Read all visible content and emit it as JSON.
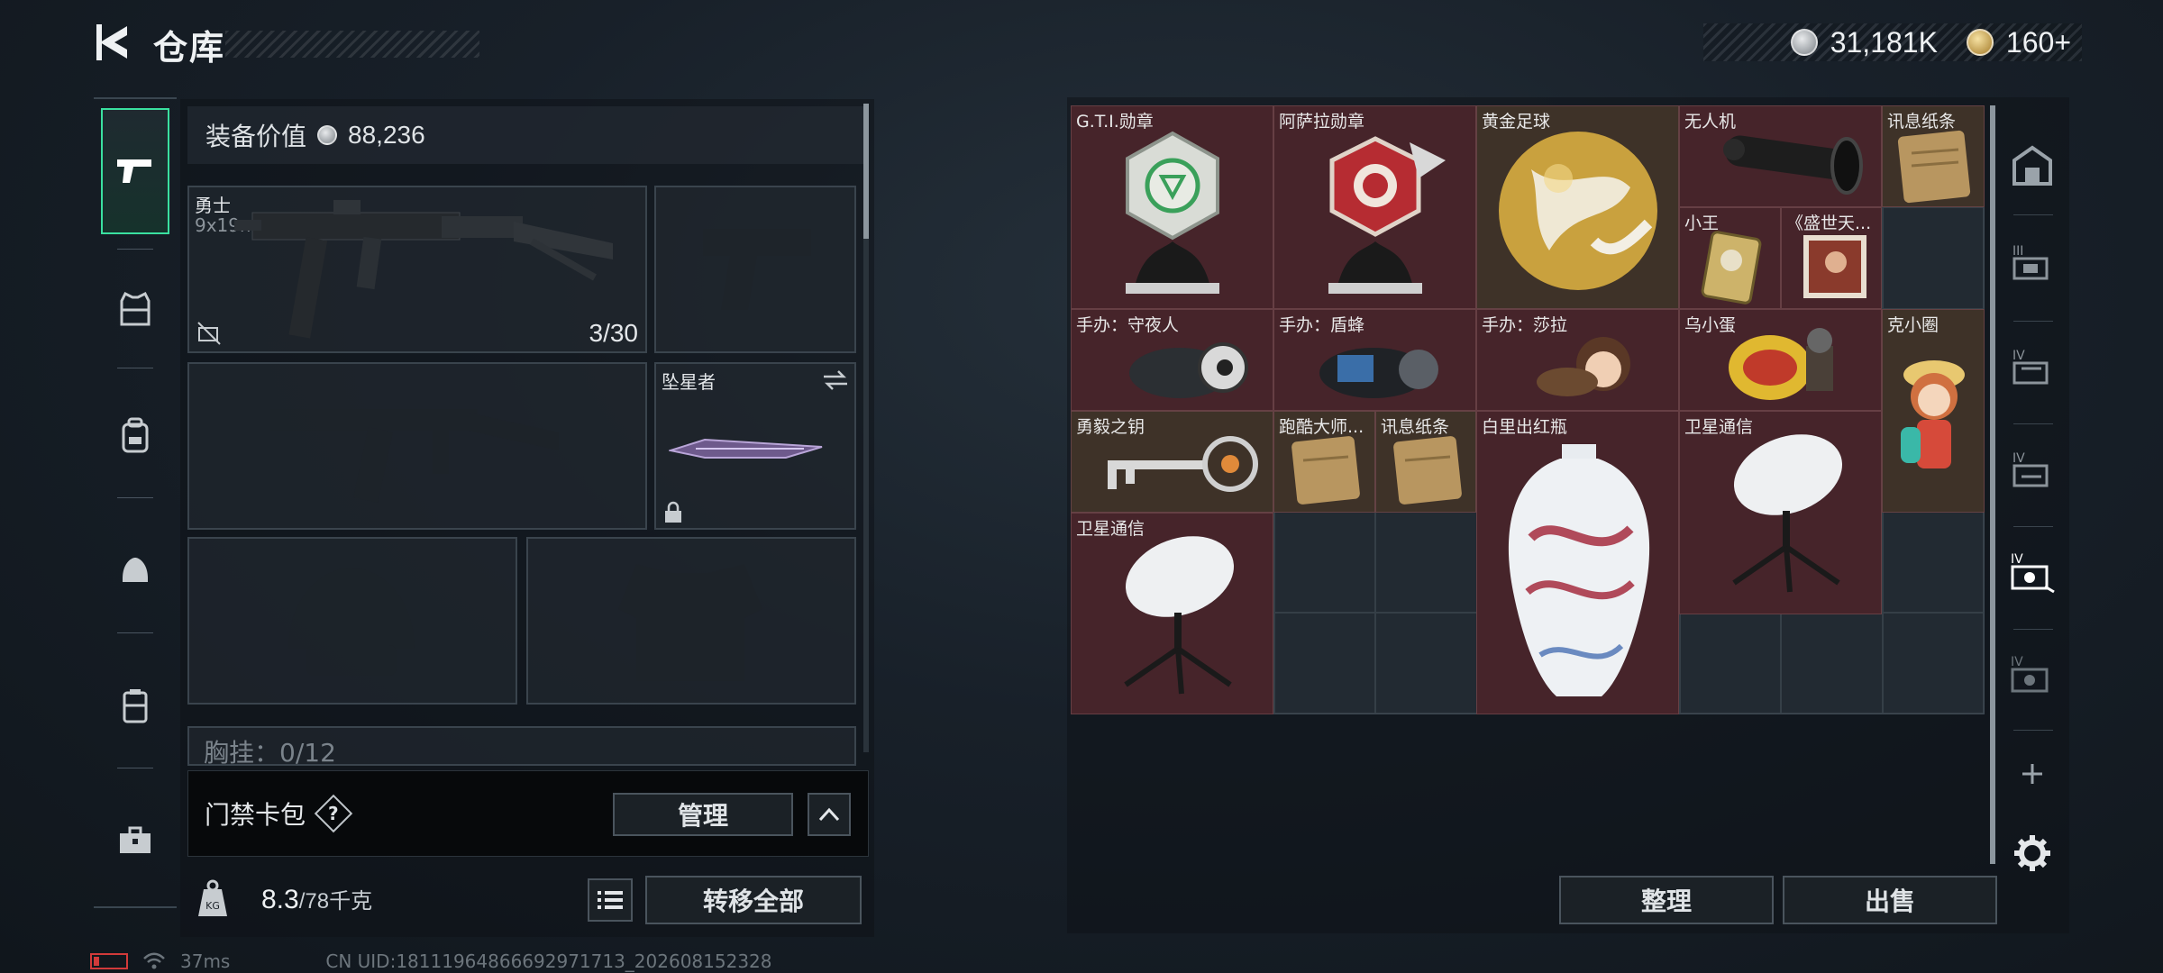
{
  "header": {
    "title": "仓库"
  },
  "currency": {
    "silver": "31,181K",
    "gold": "160+"
  },
  "loadout": {
    "equip_value_label": "装备价值",
    "equip_value": "88,236",
    "primary_weapon": {
      "name": "勇士",
      "caliber": "9x19mm",
      "ammo": "3/30"
    },
    "melee": {
      "name": "坠星者"
    },
    "chest_rig_partial": "胸挂：0/12",
    "card_pack_label": "门禁卡包",
    "help_glyph": "?",
    "manage_label": "管理",
    "weight_current": "8.3",
    "weight_max": "/78千克",
    "transfer_all_label": "转移全部"
  },
  "storage": {
    "items": [
      {
        "name": "G.T.I.勋章",
        "color": "red"
      },
      {
        "name": "阿萨拉勋章",
        "color": "red"
      },
      {
        "name": "黄金足球",
        "color": "brown"
      },
      {
        "name": "无人机",
        "color": "red"
      },
      {
        "name": "讯息纸条",
        "color": "brown"
      },
      {
        "name": "小王",
        "color": "red"
      },
      {
        "name": "《盛世天...",
        "color": "red"
      },
      {
        "name": "手办：守夜人",
        "color": "red"
      },
      {
        "name": "手办：盾蜂",
        "color": "red"
      },
      {
        "name": "手办：莎拉",
        "color": "red"
      },
      {
        "name": "乌小蛋",
        "color": "red"
      },
      {
        "name": "克小圈",
        "color": "brown"
      },
      {
        "name": "勇毅之钥",
        "color": "brown"
      },
      {
        "name": "跑酷大师...",
        "color": "brown"
      },
      {
        "name": "讯息纸条",
        "color": "brown"
      },
      {
        "name": "白里出红瓶",
        "color": "red"
      },
      {
        "name": "卫星通信",
        "color": "red"
      },
      {
        "name": "卫星通信",
        "color": "red"
      }
    ],
    "sort_label": "整理",
    "sell_label": "出售"
  },
  "status": {
    "ping": "37ms",
    "uid": "CN UID:18111964866692971713_202608152328"
  }
}
